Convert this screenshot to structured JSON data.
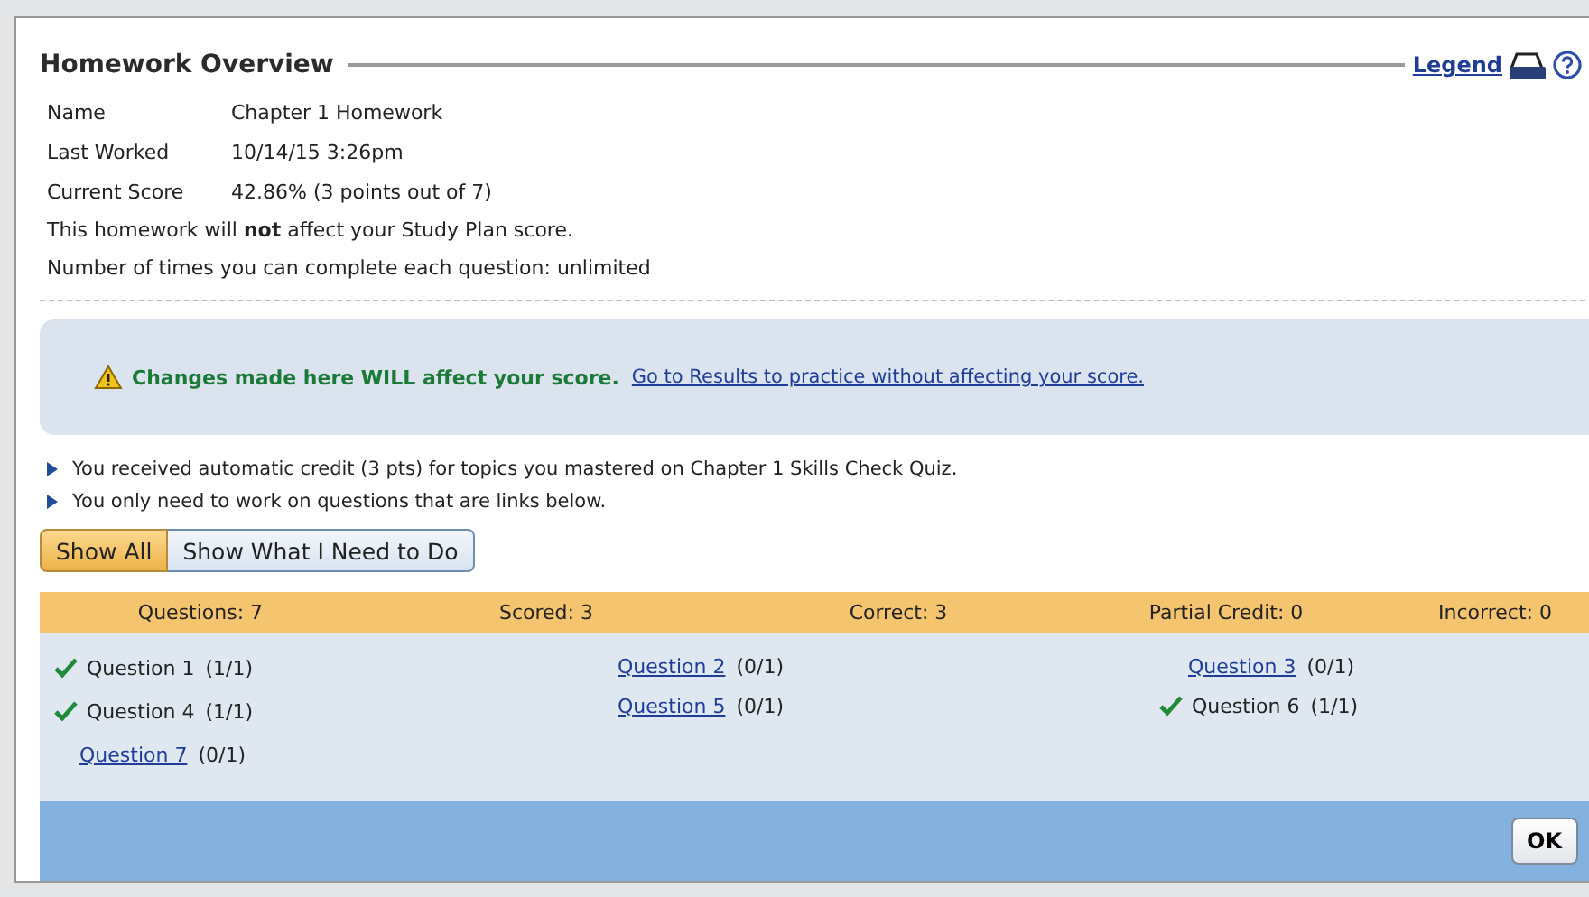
{
  "header": {
    "title": "Homework Overview",
    "legend_link": "Legend"
  },
  "details": [
    {
      "label": "Name",
      "value": "Chapter 1 Homework"
    },
    {
      "label": "Last Worked",
      "value": "10/14/15 3:26pm"
    },
    {
      "label": "Current Score",
      "value": "42.86% (3 points out of 7)"
    }
  ],
  "notes": [
    "This homework will **not** affect your Study Plan score.",
    "Number of times you can complete each question: unlimited"
  ],
  "alert": {
    "message": "Changes made here WILL affect your score.",
    "link": "Go to Results to practice without affecting your score."
  },
  "bullets": [
    "You received automatic credit (3 pts) for topics you mastered on Chapter 1 Skills Check Quiz.",
    "You only need to work on questions that are links below."
  ],
  "view_buttons": [
    {
      "label": "Show All",
      "selected": true
    },
    {
      "label": "Show What I Need to Do",
      "selected": false
    }
  ],
  "stats": [
    "Questions: 7",
    "Scored: 3",
    "Correct: 3",
    "Partial Credit: 0",
    "Incorrect: 0"
  ],
  "question_columns": [
    [
      {
        "label": "Question 1",
        "score": "(1/1)",
        "correct": true
      },
      {
        "label": "Question 4",
        "score": "(1/1)",
        "correct": true
      },
      {
        "label": "Question 7",
        "score": "(0/1)",
        "correct": false
      }
    ],
    [
      {
        "label": "Question 2",
        "score": "(0/1)",
        "correct": false
      },
      {
        "label": "Question 5",
        "score": "(0/1)",
        "correct": false
      }
    ],
    [
      {
        "label": "Question 3",
        "score": "(0/1)",
        "correct": false
      },
      {
        "label": "Question 6",
        "score": "(1/1)",
        "correct": true
      }
    ]
  ],
  "footer": {
    "ok_button": "OK"
  }
}
